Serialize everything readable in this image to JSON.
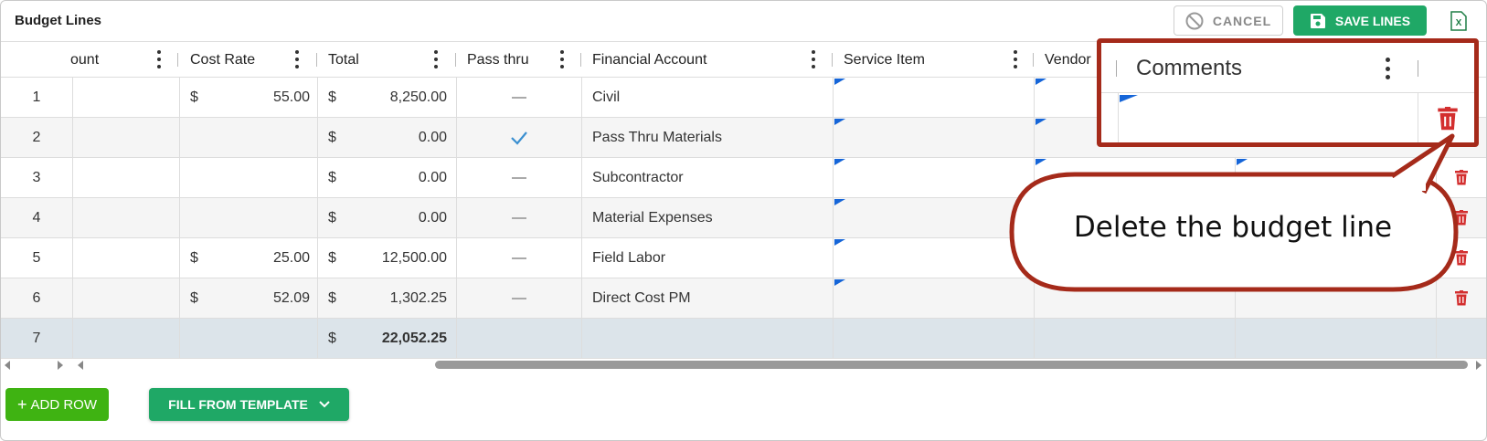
{
  "panel": {
    "title": "Budget Lines"
  },
  "toolbar": {
    "cancel_label": "CANCEL",
    "save_label": "SAVE LINES",
    "export_icon": "excel-icon"
  },
  "columns": [
    "ount",
    "Cost Rate",
    "Total",
    "Pass thru",
    "Financial Account",
    "Service Item",
    "Vendor",
    "Comments"
  ],
  "rows": [
    {
      "num": "1",
      "cost_currency": "$",
      "cost_rate": "55.00",
      "total_currency": "$",
      "total": "8,250.00",
      "pass_thru": false,
      "account": "Civil"
    },
    {
      "num": "2",
      "cost_currency": "",
      "cost_rate": "",
      "total_currency": "$",
      "total": "0.00",
      "pass_thru": true,
      "account": "Pass Thru Materials"
    },
    {
      "num": "3",
      "cost_currency": "",
      "cost_rate": "",
      "total_currency": "$",
      "total": "0.00",
      "pass_thru": false,
      "account": "Subcontractor"
    },
    {
      "num": "4",
      "cost_currency": "",
      "cost_rate": "",
      "total_currency": "$",
      "total": "0.00",
      "pass_thru": false,
      "account": "Material Expenses"
    },
    {
      "num": "5",
      "cost_currency": "$",
      "cost_rate": "25.00",
      "total_currency": "$",
      "total": "12,500.00",
      "pass_thru": false,
      "account": "Field Labor"
    },
    {
      "num": "6",
      "cost_currency": "$",
      "cost_rate": "52.09",
      "total_currency": "$",
      "total": "1,302.25",
      "pass_thru": false,
      "account": "Direct Cost PM"
    }
  ],
  "total_row": {
    "num": "7",
    "currency": "$",
    "total": "22,052.25"
  },
  "footer": {
    "add_row_label": "ADD ROW",
    "fill_template_label": "FILL FROM TEMPLATE"
  },
  "callout": {
    "text": "Delete the budget line",
    "highlight_title": "Comments"
  },
  "colors": {
    "accent_green": "#1fa866",
    "add_green": "#3fb312",
    "delete_red": "#d32f2f",
    "callout_border": "#a52a1a",
    "check_blue": "#3a8fd0"
  }
}
